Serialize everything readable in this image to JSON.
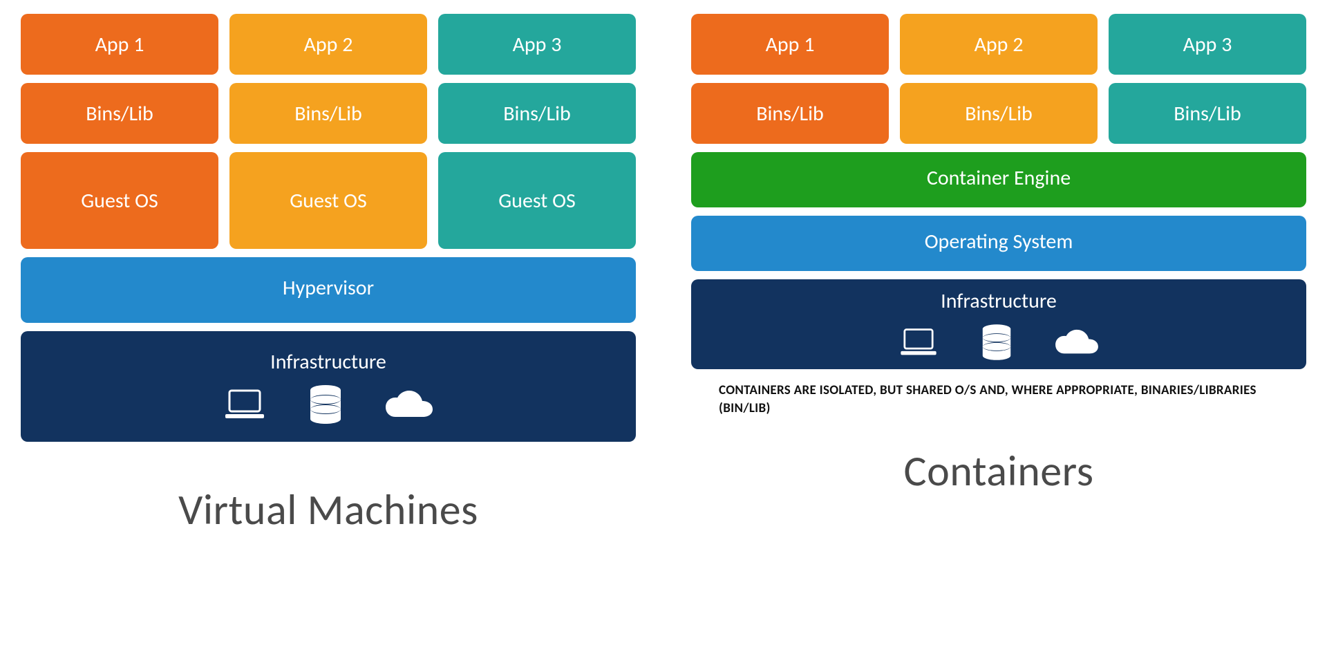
{
  "vm": {
    "apps": [
      "App 1",
      "App 2",
      "App 3"
    ],
    "bins": [
      "Bins/Lib",
      "Bins/Lib",
      "Bins/Lib"
    ],
    "guestos": [
      "Guest OS",
      "Guest OS",
      "Guest OS"
    ],
    "hypervisor": "Hypervisor",
    "infrastructure": "Infrastructure",
    "title": "Virtual Machines"
  },
  "ct": {
    "apps": [
      "App 1",
      "App 2",
      "App 3"
    ],
    "bins": [
      "Bins/Lib",
      "Bins/Lib",
      "Bins/Lib"
    ],
    "engine": "Container Engine",
    "os": "Operating System",
    "infrastructure": "Infrastructure",
    "note": "CONTAINERS ARE ISOLATED, BUT SHARED O/S AND, WHERE APPROPRIATE, BINARIES/LIBRARIES (BIN/LIB)",
    "title": "Containers"
  },
  "colors": {
    "orange": "#ed6b1d",
    "amber": "#f5a21f",
    "teal": "#24a79c",
    "blue": "#2389cc",
    "navy": "#12335f",
    "green": "#1e9e1e"
  }
}
